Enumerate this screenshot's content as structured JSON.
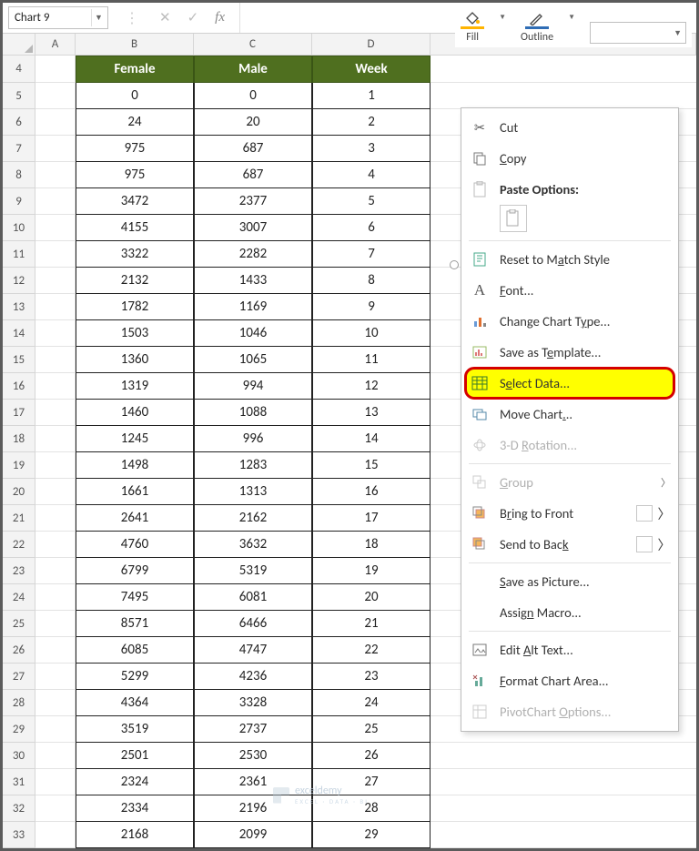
{
  "name_box": "Chart 9",
  "fx_label": "fx",
  "mini_toolbar": {
    "fill": "Fill",
    "outline": "Outline"
  },
  "columns": {
    "A": "A",
    "B": "B",
    "C": "C",
    "D": "D"
  },
  "headers": {
    "female": "Female",
    "male": "Male",
    "week": "Week"
  },
  "rows": [
    {
      "n": 4
    },
    {
      "n": 5,
      "f": "0",
      "m": "0",
      "w": "1"
    },
    {
      "n": 6,
      "f": "24",
      "m": "20",
      "w": "2"
    },
    {
      "n": 7,
      "f": "975",
      "m": "687",
      "w": "3"
    },
    {
      "n": 8,
      "f": "975",
      "m": "687",
      "w": "4"
    },
    {
      "n": 9,
      "f": "3472",
      "m": "2377",
      "w": "5"
    },
    {
      "n": 10,
      "f": "4155",
      "m": "3007",
      "w": "6"
    },
    {
      "n": 11,
      "f": "3322",
      "m": "2282",
      "w": "7"
    },
    {
      "n": 12,
      "f": "2132",
      "m": "1433",
      "w": "8"
    },
    {
      "n": 13,
      "f": "1782",
      "m": "1169",
      "w": "9"
    },
    {
      "n": 14,
      "f": "1503",
      "m": "1046",
      "w": "10"
    },
    {
      "n": 15,
      "f": "1360",
      "m": "1065",
      "w": "11"
    },
    {
      "n": 16,
      "f": "1319",
      "m": "994",
      "w": "12"
    },
    {
      "n": 17,
      "f": "1460",
      "m": "1088",
      "w": "13"
    },
    {
      "n": 18,
      "f": "1245",
      "m": "996",
      "w": "14"
    },
    {
      "n": 19,
      "f": "1498",
      "m": "1283",
      "w": "15"
    },
    {
      "n": 20,
      "f": "1661",
      "m": "1313",
      "w": "16"
    },
    {
      "n": 21,
      "f": "2641",
      "m": "2162",
      "w": "17"
    },
    {
      "n": 22,
      "f": "4760",
      "m": "3632",
      "w": "18"
    },
    {
      "n": 23,
      "f": "6799",
      "m": "5319",
      "w": "19"
    },
    {
      "n": 24,
      "f": "7495",
      "m": "6081",
      "w": "20"
    },
    {
      "n": 25,
      "f": "8571",
      "m": "6466",
      "w": "21"
    },
    {
      "n": 26,
      "f": "6085",
      "m": "4747",
      "w": "22"
    },
    {
      "n": 27,
      "f": "5299",
      "m": "4236",
      "w": "23"
    },
    {
      "n": 28,
      "f": "4364",
      "m": "3328",
      "w": "24"
    },
    {
      "n": 29,
      "f": "3519",
      "m": "2737",
      "w": "25"
    },
    {
      "n": 30,
      "f": "2501",
      "m": "2530",
      "w": "26"
    },
    {
      "n": 31,
      "f": "2324",
      "m": "2361",
      "w": "27"
    },
    {
      "n": 32,
      "f": "2334",
      "m": "2196",
      "w": "28"
    },
    {
      "n": 33,
      "f": "2168",
      "m": "2099",
      "w": "29"
    }
  ],
  "ctx": {
    "cut": "Cut",
    "copy": "Copy",
    "paste_options": "Paste Options:",
    "reset": "Reset to Match Style",
    "font": "Font...",
    "change_chart_type": "Change Chart Type...",
    "save_template": "Save as Template...",
    "select_data": "Select Data...",
    "move_chart": "Move Chart...",
    "rotation": "3-D Rotation...",
    "group": "Group",
    "bring_front": "Bring to Front",
    "send_back": "Send to Back",
    "save_picture": "Save as Picture...",
    "assign_macro": "Assign Macro...",
    "edit_alt": "Edit Alt Text...",
    "format_chart": "Format Chart Area...",
    "pivot_opts": "PivotChart Options..."
  },
  "watermark": {
    "brand": "exceldemy",
    "sub": "EXCEL · DATA · BI"
  }
}
